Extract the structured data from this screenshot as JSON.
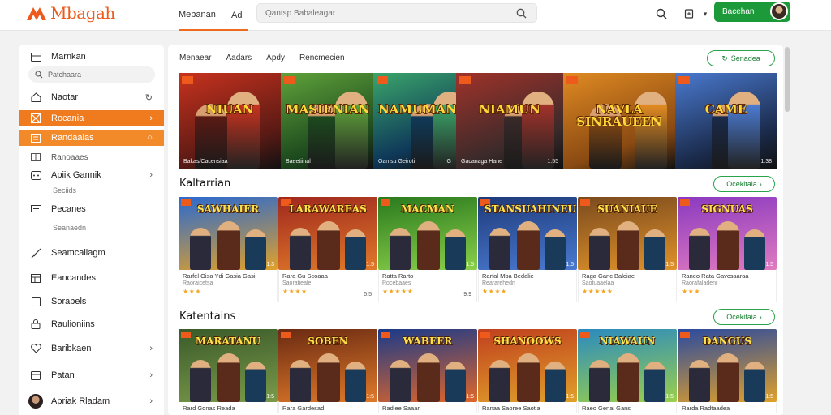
{
  "header": {
    "logo_text": "Mbagah",
    "nav": [
      {
        "label": "Mebanan"
      },
      {
        "label": "Ad"
      }
    ],
    "search_placeholder": "Qantsp Babaleagar",
    "user_label": "Bacehan"
  },
  "sidebar": {
    "title": "Marnkan",
    "search_placeholder": "Patchaara",
    "items": [
      {
        "label": "Naotar",
        "icon": "home-icon"
      },
      {
        "label": "Rocania",
        "icon": "grid-icon"
      },
      {
        "label": "Randaaias",
        "icon": "list-icon"
      },
      {
        "label": "Ranoaaes",
        "icon": "layout-icon"
      },
      {
        "label": "Apiik Gannik",
        "icon": "gamepad-icon"
      },
      {
        "label": "Pecanes",
        "icon": "screen-icon"
      },
      {
        "label": "Seamcailagm",
        "icon": "sword-icon"
      },
      {
        "label": "Eancandes",
        "icon": "table-icon"
      },
      {
        "label": "Sorabels",
        "icon": "square-icon"
      },
      {
        "label": "Raulioniins",
        "icon": "lock-icon"
      },
      {
        "label": "Baribkaen",
        "icon": "heart-icon"
      },
      {
        "label": "Patan",
        "icon": "calendar-icon"
      },
      {
        "label": "Apriak Rladam",
        "icon": "avatar-icon"
      }
    ],
    "subs": [
      "Seciids",
      "Seanaedn"
    ]
  },
  "main": {
    "tabs": [
      {
        "label": "Menaear"
      },
      {
        "label": "Aadars"
      },
      {
        "label": "Apdy"
      },
      {
        "label": "Rencmecien"
      }
    ],
    "see_all": "Senadea",
    "hero": [
      {
        "title": "NIUAN",
        "caption": "Bakas/Cacensiaa",
        "num": "",
        "bg": "#5a1a14",
        "fg": "#c8321e"
      },
      {
        "title": "MASIENIAN",
        "caption": "Baeetiinal",
        "num": "",
        "bg": "#1d4a1e",
        "fg": "#5fa23a"
      },
      {
        "title": "NAMUMAN",
        "caption": "Oamsu Geiroti",
        "num": "G",
        "bg": "#0f3a5a",
        "fg": "#3aa56a"
      },
      {
        "title": "NIAMUN",
        "caption": "Gacanaga Hane",
        "num": "1:55",
        "bg": "#3a2a2a",
        "fg": "#a0322a"
      },
      {
        "title": "NAVLA SINRAUEEN",
        "caption": "",
        "num": "",
        "bg": "#8a4a12",
        "fg": "#e08a22"
      },
      {
        "title": "CAME",
        "caption": "",
        "num": "1:38",
        "bg": "#1a2a4a",
        "fg": "#4a7ad0"
      }
    ],
    "sections": [
      {
        "title": "Kaltarrian",
        "action": "Ocekitaia",
        "cards": [
          {
            "title": "SAWHAIER",
            "name": "Rarfel Oisa Ydi Gasia Gasi",
            "sub": "Raoraicetsa",
            "stars": "★★★",
            "count": "",
            "num": "1:3",
            "bg1": "#2a6ad0",
            "bg2": "#e0a02a"
          },
          {
            "title": "LARAWAREAS",
            "name": "Rara Gu Scoaaa",
            "sub": "Saoratieale",
            "stars": "★★★★",
            "count": "5:5",
            "num": "1:5",
            "bg1": "#a0281e",
            "bg2": "#e07a2a"
          },
          {
            "title": "MACMAN",
            "name": "Ratta Rarto",
            "sub": "Rocebaaes",
            "stars": "★★★★★",
            "count": "9:9",
            "num": "1:5",
            "bg1": "#2a7a1e",
            "bg2": "#8ad04a"
          },
          {
            "title": "STANSUAHINEU",
            "name": "Rarfal Mba Bedalie",
            "sub": "Reararehedn",
            "stars": "★★★★",
            "count": "",
            "num": "1:5",
            "bg1": "#1e3a7a",
            "bg2": "#4a7ad0"
          },
          {
            "title": "SUANIAUE",
            "name": "Raga Ganc Baloiae",
            "sub": "Saotuaaelaa",
            "stars": "★★★★★",
            "count": "",
            "num": "1:5",
            "bg1": "#7a4a1e",
            "bg2": "#e0922a"
          },
          {
            "title": "SIGNUAS",
            "name": "Raneo Rata Gavcsaaraa",
            "sub": "Raorafaladenr",
            "stars": "★★★",
            "count": "",
            "num": "1:5",
            "bg1": "#8a3ac0",
            "bg2": "#e07ac0"
          }
        ]
      },
      {
        "title": "Katentains",
        "action": "Ocekitaia",
        "cards": [
          {
            "title": "MARATANU",
            "name": "Rard Gdnas Reada",
            "sub": "",
            "stars": "",
            "count": "",
            "num": "1:5",
            "bg1": "#3a5a2a",
            "bg2": "#7a9a4a"
          },
          {
            "title": "SOBEN",
            "name": "Rara Gardesad",
            "sub": "",
            "stars": "",
            "count": "",
            "num": "1:5",
            "bg1": "#6a2a12",
            "bg2": "#e07a2a"
          },
          {
            "title": "WABEER",
            "name": "Radiee Saaan",
            "sub": "",
            "stars": "",
            "count": "",
            "num": "1:5",
            "bg1": "#1a3a8a",
            "bg2": "#e0662a"
          },
          {
            "title": "SHANOOWS",
            "name": "Ranaa Saoree Saotia",
            "sub": "",
            "stars": "",
            "count": "",
            "num": "1:5",
            "bg1": "#c0401e",
            "bg2": "#e0a02a"
          },
          {
            "title": "NIAWAUN",
            "name": "Raeo Genai Gans",
            "sub": "",
            "stars": "",
            "count": "",
            "num": "1:5",
            "bg1": "#2a8ac0",
            "bg2": "#9ad04a"
          },
          {
            "title": "DANGUS",
            "name": "Rarda Radtaadea",
            "sub": "",
            "stars": "",
            "count": "",
            "num": "1:5",
            "bg1": "#2a4aa0",
            "bg2": "#e0a02a"
          }
        ]
      }
    ]
  }
}
